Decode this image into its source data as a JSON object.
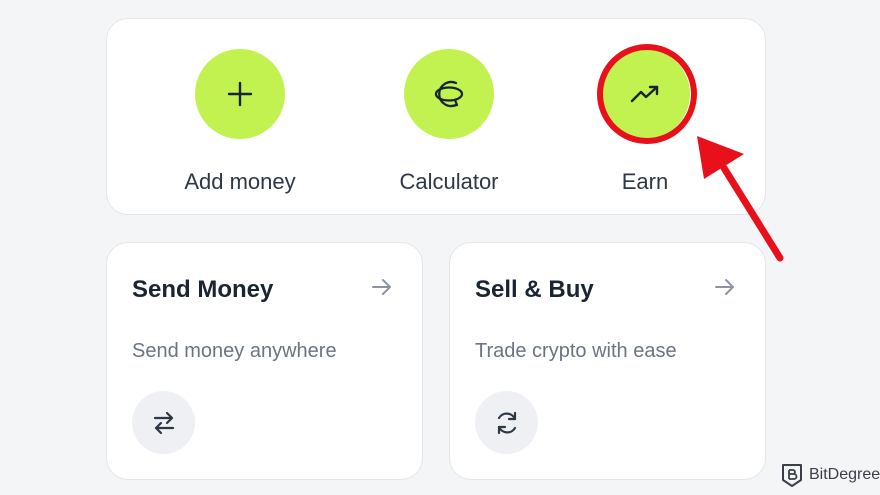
{
  "quick_actions": [
    {
      "label": "Add money",
      "icon": "plus-icon"
    },
    {
      "label": "Calculator",
      "icon": "calculator-icon"
    },
    {
      "label": "Earn",
      "icon": "trending-up-icon"
    }
  ],
  "feature_cards": [
    {
      "title": "Send Money",
      "description": "Send money anywhere",
      "icon": "swap-arrows-icon"
    },
    {
      "title": "Sell & Buy",
      "description": "Trade crypto with ease",
      "icon": "refresh-icon"
    }
  ],
  "watermark": {
    "text": "BitDegree"
  },
  "colors": {
    "accent": "#c2f24f",
    "highlight": "#e8101a",
    "background": "#f4f5f7",
    "card": "#ffffff",
    "muted_text": "#6b7482"
  }
}
